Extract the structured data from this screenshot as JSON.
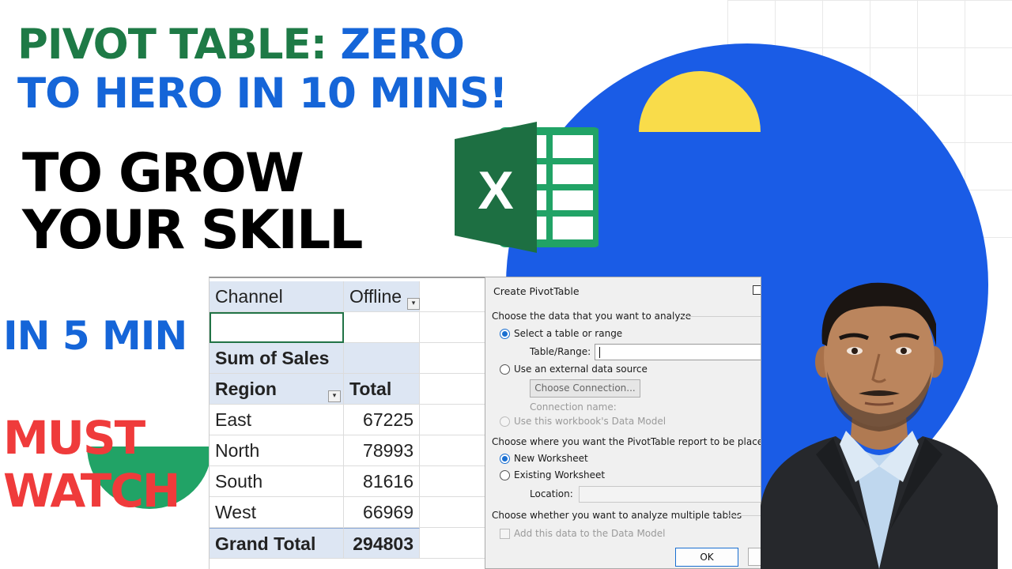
{
  "headline": {
    "line1_green": "PIVOT TABLE:",
    "line1_blue": "ZERO",
    "line2": "TO HERO IN 10 MINS!",
    "line3": "TO GROW",
    "line4": "YOUR SKILL",
    "line5": "IN 5 MIN",
    "line6": "MUST",
    "line7": "WATCH"
  },
  "excel_logo": {
    "letter": "X",
    "icon": "excel-icon"
  },
  "sheet": {
    "filter_label": "Channel",
    "filter_value": "Offline",
    "values_label": "Sum of Sales",
    "row_label": "Region",
    "col_label": "Total",
    "rows": [
      {
        "region": "East",
        "total": "67225"
      },
      {
        "region": "North",
        "total": "78993"
      },
      {
        "region": "South",
        "total": "81616"
      },
      {
        "region": "West",
        "total": "66969"
      }
    ],
    "grand_total_label": "Grand Total",
    "grand_total_value": "294803"
  },
  "dialog": {
    "title": "Create PivotTable",
    "section1": "Choose the data that you want to analyze",
    "opt_select_table": "Select a table or range",
    "table_range_label": "Table/Range:",
    "table_range_value": "",
    "opt_external": "Use an external data source",
    "choose_connection": "Choose Connection...",
    "connection_name": "Connection name:",
    "opt_data_model": "Use this workbook's Data Model",
    "section2": "Choose where you want the PivotTable report to be placed",
    "opt_new_ws": "New Worksheet",
    "opt_existing_ws": "Existing Worksheet",
    "location_label": "Location:",
    "location_value": "",
    "section3": "Choose whether you want to analyze multiple tables",
    "add_data_model": "Add this data to the Data Model",
    "ok": "OK"
  },
  "colors": {
    "green": "#1e7a46",
    "blue": "#1565d8",
    "red": "#ef3b3b",
    "circle_blue": "#1a5ce6",
    "yellow": "#f9dc4a"
  }
}
